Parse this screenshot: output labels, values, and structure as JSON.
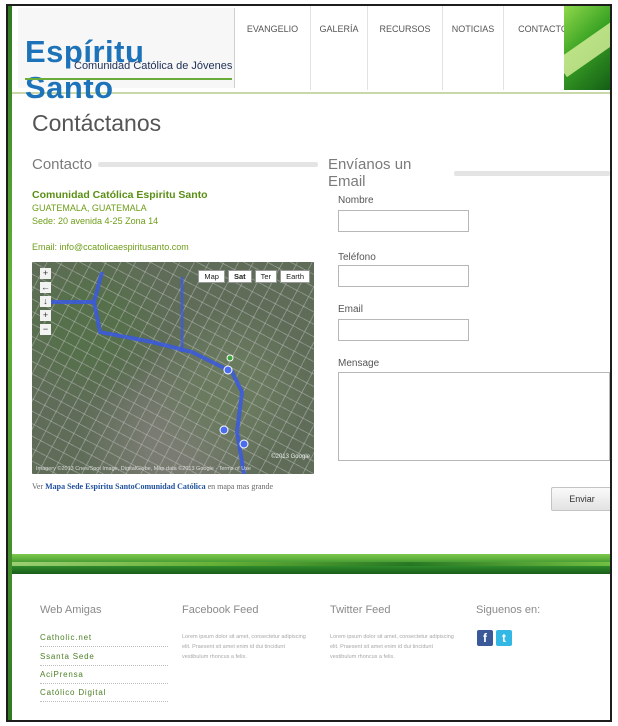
{
  "header": {
    "logo_main": "Espíritu Santo",
    "logo_sub": "Comunidad Católica de Jóvenes",
    "nav": [
      "EVANGELIO",
      "GALERÍA",
      "RECURSOS",
      "NOTICIAS",
      "CONTACTOS"
    ]
  },
  "main": {
    "page_title": "Contáctanos",
    "contact_heading": "Contacto",
    "email_heading": "Envíanos un Email",
    "org_name": "Comunidad Católica Espiritu Santo",
    "city": "GUATEMALA, GUATEMALA",
    "address": "Sede: 20 avenida 4-25 Zona 14",
    "email": "Email: info@ccatolicaespiritusanto.com"
  },
  "map": {
    "types": [
      "Map",
      "Sat",
      "Ter",
      "Earth"
    ],
    "active_type": "Sat",
    "controls": [
      "+",
      "←",
      "↓",
      "+",
      "−"
    ],
    "google_label": "©2013 Google",
    "attribution": "Imagery ©2013 Cnes/Spot Image, DigitalGlobe, Map data ©2013 Google · Terms of Use",
    "link_prefix": "Ver",
    "link_text": "Mapa Sede Espíritu SantoComunidad Católica",
    "link_suffix": "en mapa mas grande"
  },
  "form": {
    "name_label": "Nombre",
    "phone_label": "Teléfono",
    "email_label": "Email",
    "message_label": "Mensage",
    "send_label": "Enviar"
  },
  "footer": {
    "web_heading": "Web Amigas",
    "links": [
      "Catholic.net",
      "Ssanta Sede",
      "AciPrensa",
      "Católico Digital"
    ],
    "facebook_heading": "Facebook Feed",
    "twitter_heading": "Twitter Feed",
    "social_heading": "Siguenos en:",
    "lorem": "Lorem ipsum dolor sit amet, consectetur adipiscing elit. Praesent sit amet enim id dui tincidunt vestibulum rhoncus a felis.",
    "social": [
      {
        "icon": "facebook-icon",
        "glyph": "f",
        "color": "#3b5998"
      },
      {
        "icon": "twitter-icon",
        "glyph": "t",
        "color": "#33b7e5"
      }
    ]
  },
  "colors": {
    "accent_green": "#6e9d19",
    "logo_blue": "#1d73b9",
    "link_blue": "#1d4f9b"
  }
}
